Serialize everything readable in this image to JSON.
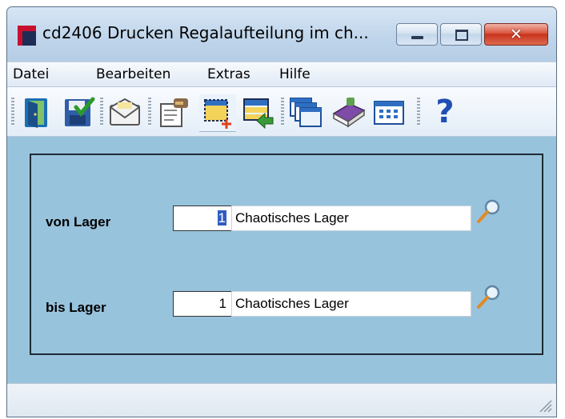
{
  "window": {
    "title": "cd2406 Drucken Regalaufteilung im ch...",
    "close_symbol": "✕"
  },
  "menu": {
    "items": [
      "Datei",
      "Bearbeiten",
      "Extras",
      "Hilfe"
    ]
  },
  "toolbar": {
    "icons": [
      "exit-door-icon",
      "save-icon",
      "envelope-icon",
      "printer-edit-icon",
      "selection-icon",
      "list-import-icon",
      "windows-icon",
      "book-icon",
      "calendar-grid-icon",
      "help-icon"
    ],
    "help_glyph": "?"
  },
  "form": {
    "von": {
      "label": "von Lager",
      "number": "1",
      "name": "Chaotisches Lager"
    },
    "bis": {
      "label": "bis Lager",
      "number": "1",
      "name": "Chaotisches Lager"
    }
  },
  "colors": {
    "panel_bg": "#98c3dd",
    "app_red": "#c8102e",
    "app_navy": "#1d2b55"
  }
}
